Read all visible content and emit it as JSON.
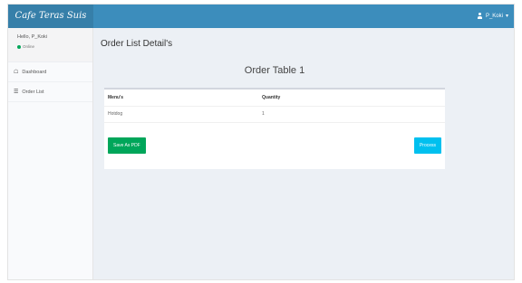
{
  "header": {
    "brand": "Cafe Teras Suis",
    "user_name": "P_Koki",
    "user_caret": "▾"
  },
  "sidebar": {
    "greeting": "Hello, P_Koki",
    "status": "Online",
    "items": [
      {
        "label": "Dashboard",
        "icon": "dashboard-icon"
      },
      {
        "label": "Order List",
        "icon": "list-icon"
      }
    ]
  },
  "main": {
    "page_title": "Order List Detail's",
    "table_title": "Order Table 1",
    "columns": [
      "Menu's",
      "Quantity"
    ],
    "rows": [
      {
        "menu": "Hotdog",
        "quantity": "1"
      }
    ],
    "save_pdf_label": "Save As PDF",
    "process_label": "Process"
  },
  "colors": {
    "topbar": "#3c8dbc",
    "brand_bg": "#367fa9",
    "save_button": "#00a65a",
    "process_button": "#00c0ef",
    "online_dot": "#00a65a"
  }
}
